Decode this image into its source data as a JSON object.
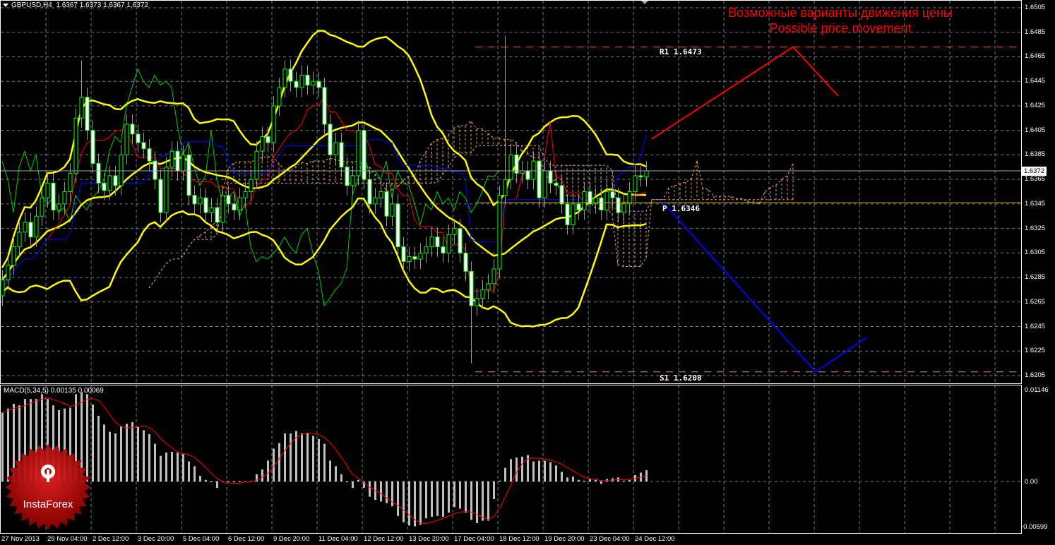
{
  "header": {
    "symbol": "GBPUSD,H4",
    "ohlc": "1.6367 1.6373 1.6367 1.6372"
  },
  "annotation": {
    "title_ru": "Возможные варианты движения цены",
    "title_en": "Possible price movement"
  },
  "levels": [
    {
      "name": "R1",
      "label": "R1 1.6473",
      "price": 1.6473,
      "color": "#ff5a1e"
    },
    {
      "name": "P",
      "label": "P 1.6346",
      "price": 1.6346,
      "color": "#d4b030"
    },
    {
      "name": "S1",
      "label": "S1 1.6208",
      "price": 1.6208,
      "color": "#e09080"
    }
  ],
  "price_axis": [
    "1.6505",
    "1.6485",
    "1.6465",
    "1.6445",
    "1.6425",
    "1.6405",
    "1.6385",
    "1.6365",
    "1.6345",
    "1.6325",
    "1.6305",
    "1.6285",
    "1.6265",
    "1.6245",
    "1.6225",
    "1.6205"
  ],
  "current_price": "1.6372",
  "macd_axis": {
    "max": "0.01146",
    "zero": "0.00",
    "min": "-0.00599"
  },
  "macd_label": "MACD(5,34,5) 0.00135 0.00069",
  "time_axis": [
    "27 Nov 2013",
    "29 Nov 04:00",
    "2 Dec 12:00",
    "3 Dec 20:00",
    "5 Dec 04:00",
    "6 Dec 12:00",
    "9 Dec 20:00",
    "11 Dec 04:00",
    "12 Dec 12:00",
    "13 Dec 20:00",
    "17 Dec 04:00",
    "18 Dec 12:00",
    "19 Dec 20:00",
    "23 Dec 04:00",
    "24 Dec 12:00"
  ],
  "logo": {
    "text": "InstaForex"
  },
  "colors": {
    "bg": "#000000",
    "candle": "#00ff00",
    "bollinger": "#ffff00",
    "tenkan": "#ff0000",
    "kijun": "#0000ff",
    "chikou": "#00cc00",
    "cloud_up": "#f4a460",
    "cloud_down": "#d8a8a8",
    "macd_bar": "#c0c0c0",
    "macd_signal": "#ff0000",
    "grid": "#708090",
    "scenario_up": "#ff0000",
    "scenario_down": "#0000ff"
  },
  "chart_data": [
    {
      "type": "candlestick",
      "title": "GBPUSD,H4",
      "ylim": [
        1.6199,
        1.6512
      ],
      "indicators": [
        "Bollinger Bands(20,2)",
        "Ichimoku Kinko Hyo(9,26,52)"
      ],
      "wick": 0.0008,
      "closes": [
        1.6283,
        1.6295,
        1.631,
        1.6322,
        1.633,
        1.6318,
        1.6335,
        1.635,
        1.6362,
        1.634,
        1.6345,
        1.6355,
        1.637,
        1.6415,
        1.6432,
        1.6405,
        1.6378,
        1.6362,
        1.6356,
        1.6368,
        1.636,
        1.6385,
        1.641,
        1.6402,
        1.6395,
        1.639,
        1.638,
        1.6365,
        1.6338,
        1.6375,
        1.6388,
        1.6372,
        1.6385,
        1.6352,
        1.6345,
        1.635,
        1.6338,
        1.6342,
        1.633,
        1.6352,
        1.6345,
        1.634,
        1.635,
        1.6355,
        1.6365,
        1.6388,
        1.64,
        1.6395,
        1.6425,
        1.644,
        1.6455,
        1.6445,
        1.644,
        1.645,
        1.6442,
        1.6445,
        1.644,
        1.641,
        1.6385,
        1.6395,
        1.6375,
        1.636,
        1.6368,
        1.6405,
        1.6365,
        1.6345,
        1.635,
        1.6355,
        1.6335,
        1.6345,
        1.631,
        1.6298,
        1.6302,
        1.63,
        1.6305,
        1.631,
        1.6318,
        1.631,
        1.6305,
        1.632,
        1.6325,
        1.6305,
        1.629,
        1.6262,
        1.6268,
        1.6275,
        1.628,
        1.6292,
        1.6352,
        1.6365,
        1.6385,
        1.637,
        1.6372,
        1.6365,
        1.638,
        1.635,
        1.6372,
        1.6362,
        1.636,
        1.6345,
        1.6328,
        1.6345,
        1.634,
        1.6355,
        1.6345,
        1.635,
        1.634,
        1.6355,
        1.635,
        1.6338,
        1.6345,
        1.6355,
        1.6368,
        1.6367,
        1.6372
      ],
      "first_open": 1.627,
      "extreme_wicks": [
        {
          "bar": 14,
          "high": 1.6462
        },
        {
          "bar": 50,
          "high": 1.6462
        },
        {
          "bar": 83,
          "low": 1.6215
        },
        {
          "bar": 89,
          "high": 1.6482
        }
      ]
    },
    {
      "type": "bar",
      "title": "MACD(5,34,5)",
      "ylim": [
        -0.00599,
        0.01146
      ],
      "signal": "SMA(5) of MACD",
      "values": [
        0.0086,
        0.0091,
        0.0097,
        0.0095,
        0.0103,
        0.0103,
        0.0103,
        0.0109,
        0.0103,
        0.0095,
        0.0089,
        0.0091,
        0.0092,
        0.0109,
        0.0111,
        0.0109,
        0.0096,
        0.0082,
        0.0071,
        0.0062,
        0.006,
        0.0069,
        0.0072,
        0.0074,
        0.0068,
        0.0064,
        0.0059,
        0.0047,
        0.0032,
        0.0036,
        0.0037,
        0.0036,
        0.0034,
        0.0025,
        0.0019,
        0.0007,
        0.0002,
        -0.0001,
        -0.0008,
        -0.0001,
        -0.0001,
        -0.0001,
        0.0,
        0.0,
        0.0,
        0.0009,
        0.0015,
        0.0026,
        0.0041,
        0.0048,
        0.006,
        0.006,
        0.0063,
        0.006,
        0.006,
        0.0057,
        0.0053,
        0.0047,
        0.0026,
        0.0019,
        0.0009,
        -0.0001,
        -0.0008,
        0.0002,
        -0.0008,
        -0.0019,
        -0.0023,
        -0.0025,
        -0.0027,
        -0.0031,
        -0.0043,
        -0.0051,
        -0.0055,
        -0.0056,
        -0.0054,
        -0.0046,
        -0.0044,
        -0.0043,
        -0.0044,
        -0.0039,
        -0.0032,
        -0.0034,
        -0.0039,
        -0.0048,
        -0.0052,
        -0.0049,
        -0.0049,
        -0.0022,
        0.0001,
        0.0017,
        0.0028,
        0.003,
        0.0031,
        0.0033,
        0.0025,
        0.0026,
        0.0026,
        0.0024,
        0.002,
        0.0012,
        0.0005,
        0.0006,
        0.0002,
        0.0001,
        0.0003,
        0.0002,
        -0.0003,
        0.0003,
        0.0004,
        0.0005,
        0.0001,
        0.0002,
        0.0008,
        0.0011,
        0.0014
      ]
    },
    {
      "type": "line",
      "title": "Possible price movement",
      "series": [
        {
          "name": "bullish-scenario",
          "bars": [
            115,
            140,
            148
          ],
          "prices": [
            1.6398,
            1.6473,
            1.6433
          ]
        },
        {
          "name": "bearish-scenario",
          "bars": [
            117,
            144,
            153
          ],
          "prices": [
            1.6346,
            1.6208,
            1.6236
          ]
        }
      ]
    }
  ]
}
